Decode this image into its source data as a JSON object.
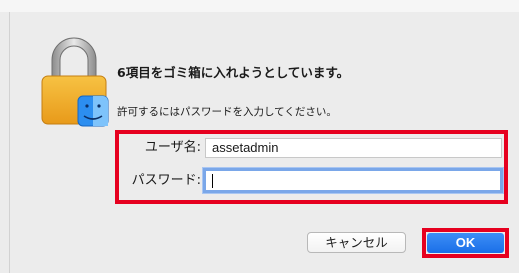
{
  "dialog": {
    "title": "6項目をゴミ箱に入れようとしています。",
    "message": "許可するにはパスワードを入力してください。",
    "username_label": "ユーザ名:",
    "username_value": "assetadmin",
    "password_label": "パスワード:",
    "password_value": "",
    "cancel_label": "キャンセル",
    "ok_label": "OK",
    "icon": "lock-icon",
    "accent_color": "#1a6fe8",
    "highlight_color": "#e6001f"
  }
}
